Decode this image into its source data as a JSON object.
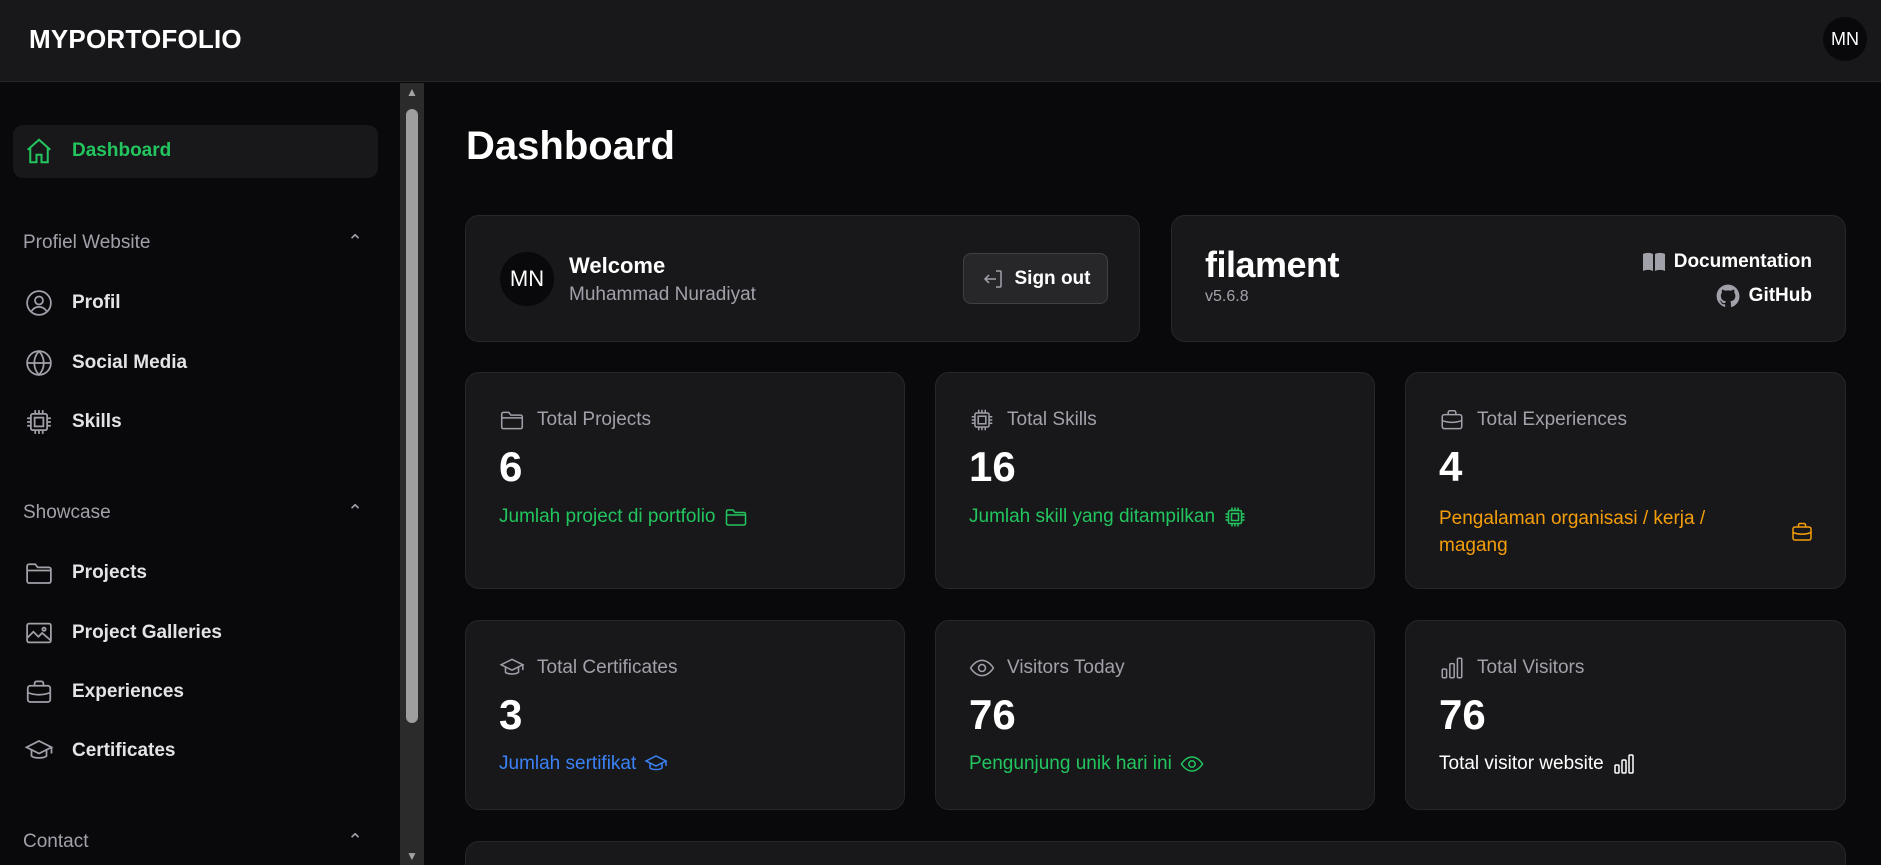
{
  "topbar": {
    "brand": "MYPORTOFOLIO",
    "avatar_initials": "MN"
  },
  "sidebar": {
    "dashboard": "Dashboard",
    "groups": [
      {
        "label": "Profiel Website",
        "items": [
          "Profil",
          "Social Media",
          "Skills"
        ]
      },
      {
        "label": "Showcase",
        "items": [
          "Projects",
          "Project Galleries",
          "Experiences",
          "Certificates"
        ]
      },
      {
        "label": "Contact",
        "items": []
      }
    ]
  },
  "main": {
    "title": "Dashboard",
    "welcome": {
      "avatar": "MN",
      "title": "Welcome",
      "name": "Muhammad Nuradiyat",
      "signout": "Sign out"
    },
    "filament": {
      "logo": "filament",
      "version": "v5.6.8",
      "documentation": "Documentation",
      "github": "GitHub"
    },
    "stats": [
      {
        "label": "Total Projects",
        "value": "6",
        "desc": "Jumlah project di portfolio",
        "color": "#22c55e",
        "icon": "folder-icon"
      },
      {
        "label": "Total Skills",
        "value": "16",
        "desc": "Jumlah skill yang ditampilkan",
        "color": "#22c55e",
        "icon": "cpu-chip-icon"
      },
      {
        "label": "Total Experiences",
        "value": "4",
        "desc": "Pengalaman organisasi / kerja / magang",
        "color": "#f59e0b",
        "icon": "briefcase-icon"
      },
      {
        "label": "Total Certificates",
        "value": "3",
        "desc": "Jumlah sertifikat",
        "color": "#3b82f6",
        "icon": "academic-cap-icon"
      },
      {
        "label": "Visitors Today",
        "value": "76",
        "desc": "Pengunjung unik hari ini",
        "color": "#22c55e",
        "icon": "eye-icon"
      },
      {
        "label": "Total Visitors",
        "value": "76",
        "desc": "Total visitor website",
        "color": "#ffffff",
        "icon": "bar-chart-icon"
      }
    ]
  },
  "colors": {
    "accent": "#22c55e",
    "background": "#09090b",
    "card": "#18181b"
  }
}
